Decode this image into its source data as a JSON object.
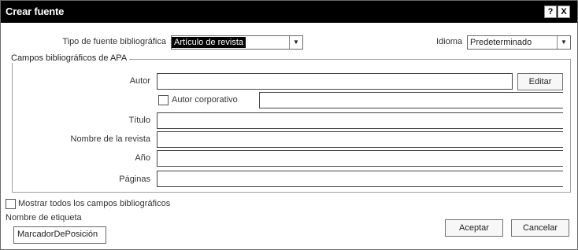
{
  "title": "Crear fuente",
  "title_buttons": {
    "help": "?",
    "close": "X"
  },
  "source_type": {
    "label": "Tipo de fuente bibliográfica",
    "value": "Artículo de revista"
  },
  "language": {
    "label": "Idioma",
    "value": "Predeterminado"
  },
  "group_title": "Campos bibliográficos de APA",
  "fields": {
    "author_label": "Autor",
    "edit_button": "Editar",
    "corporate_author_label": "Autor corporativo",
    "title_label": "Título",
    "journal_label": "Nombre de la revista",
    "year_label": "Año",
    "pages_label": "Páginas"
  },
  "show_all": "Mostrar todos los campos bibliográficos",
  "tag": {
    "label": "Nombre de etiqueta",
    "value": "MarcadorDePosición"
  },
  "buttons": {
    "accept": "Aceptar",
    "cancel": "Cancelar"
  },
  "colors": {
    "titlebar": "#000000",
    "selection": "#000000"
  }
}
